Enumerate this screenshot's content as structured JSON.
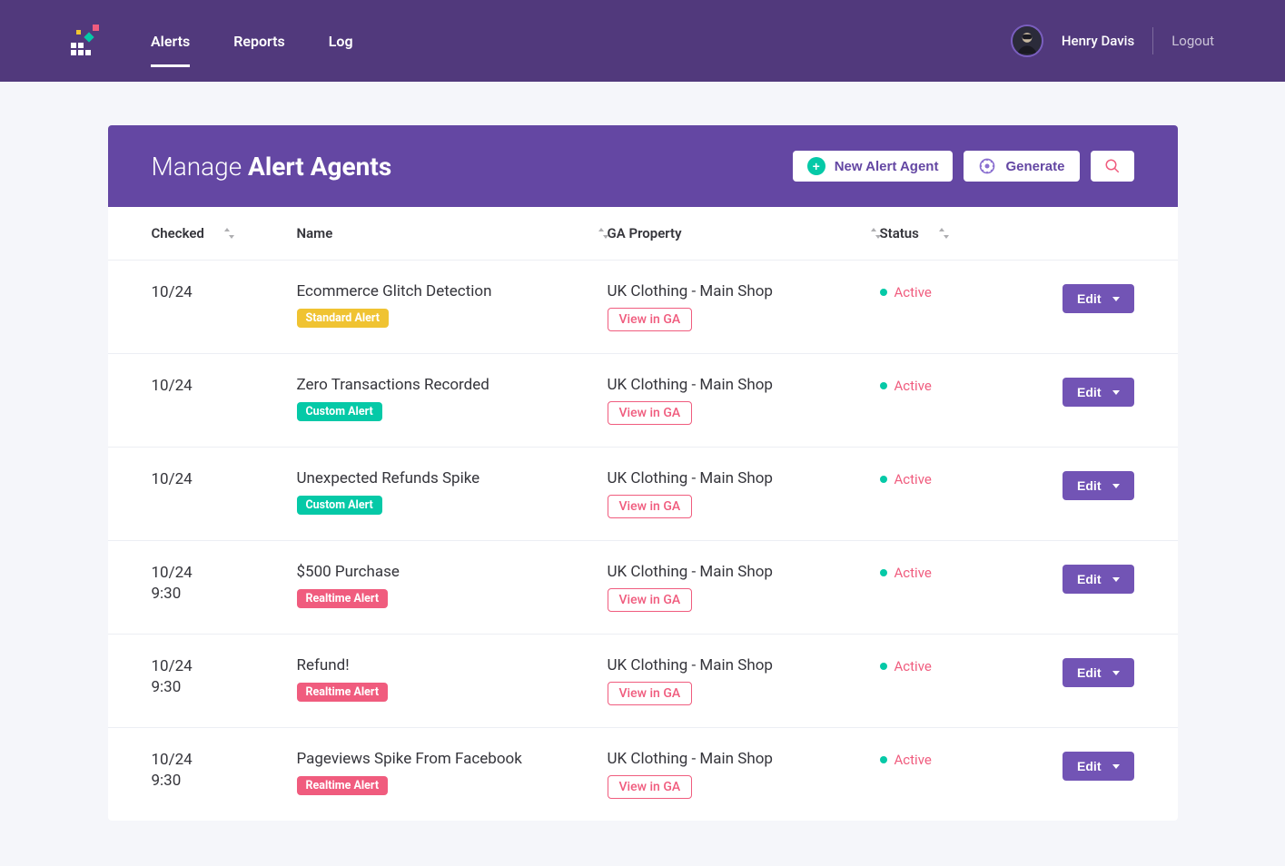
{
  "nav": {
    "items": [
      "Alerts",
      "Reports",
      "Log"
    ],
    "active_index": 0
  },
  "user": {
    "name": "Henry Davis"
  },
  "logout_label": "Logout",
  "panel": {
    "title_prefix": "Manage ",
    "title_bold": "Alert Agents",
    "new_alert_label": "New Alert Agent",
    "generate_label": "Generate"
  },
  "columns": {
    "checked": "Checked",
    "name": "Name",
    "property": "GA Property",
    "status": "Status"
  },
  "view_ga_label": "View in GA",
  "edit_label": "Edit",
  "status_active": "Active",
  "badge_labels": {
    "standard": "Standard Alert",
    "custom": "Custom Alert",
    "realtime": "Realtime Alert"
  },
  "rows": [
    {
      "checked": "10/24",
      "time": "",
      "name": "Ecommerce Glitch Detection",
      "badge": "standard",
      "property": "UK Clothing - Main Shop",
      "status": "active"
    },
    {
      "checked": "10/24",
      "time": "",
      "name": "Zero Transactions Recorded",
      "badge": "custom",
      "property": "UK Clothing - Main Shop",
      "status": "active"
    },
    {
      "checked": "10/24",
      "time": "",
      "name": "Unexpected Refunds Spike",
      "badge": "custom",
      "property": "UK Clothing - Main Shop",
      "status": "active"
    },
    {
      "checked": "10/24",
      "time": "9:30",
      "name": "$500 Purchase",
      "badge": "realtime",
      "property": "UK Clothing - Main Shop",
      "status": "active"
    },
    {
      "checked": "10/24",
      "time": "9:30",
      "name": "Refund!",
      "badge": "realtime",
      "property": "UK Clothing - Main Shop",
      "status": "active"
    },
    {
      "checked": "10/24",
      "time": "9:30",
      "name": "Pageviews Spike From Facebook",
      "badge": "realtime",
      "property": "UK Clothing - Main Shop",
      "status": "active"
    }
  ]
}
